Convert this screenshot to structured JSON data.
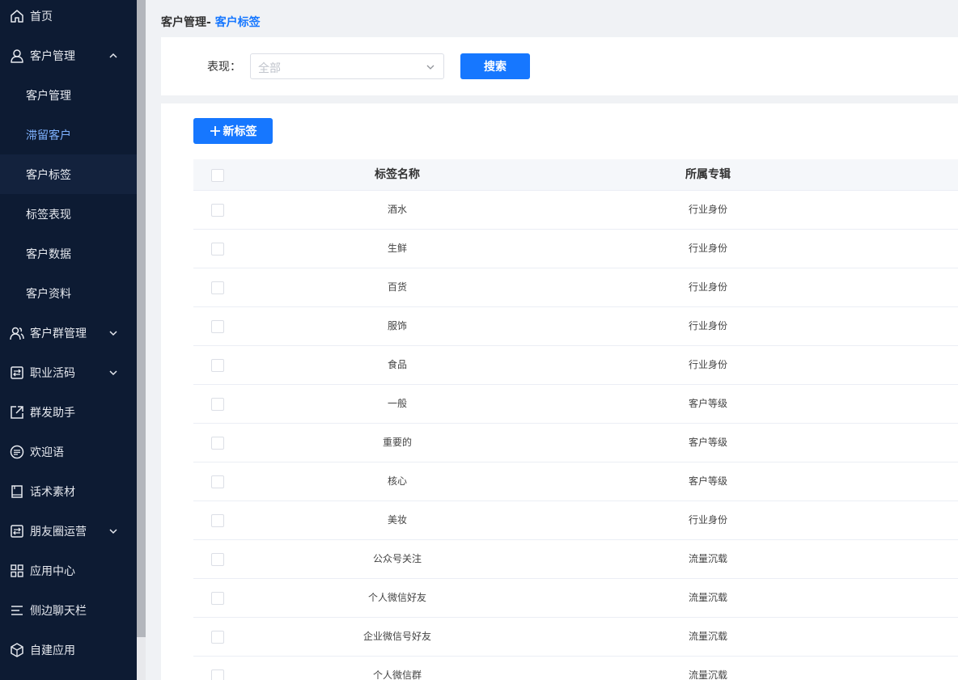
{
  "sidebar": {
    "items": [
      {
        "label": "首页",
        "icon": "home-icon"
      },
      {
        "label": "客户管理",
        "icon": "user-icon",
        "expanded": true,
        "children": [
          {
            "label": "客户管理"
          },
          {
            "label": "滞留客户"
          },
          {
            "label": "客户标签"
          },
          {
            "label": "标签表现"
          },
          {
            "label": "客户数据"
          },
          {
            "label": "客户资料"
          }
        ]
      },
      {
        "label": "客户群管理",
        "icon": "users-icon"
      },
      {
        "label": "职业活码",
        "icon": "qrcode-icon"
      },
      {
        "label": "群发助手",
        "icon": "share-icon"
      },
      {
        "label": "欢迎语",
        "icon": "message-icon"
      },
      {
        "label": "话术素材",
        "icon": "book-icon"
      },
      {
        "label": "朋友圈运营",
        "icon": "moments-icon"
      },
      {
        "label": "应用中心",
        "icon": "apps-icon"
      },
      {
        "label": "侧边聊天栏",
        "icon": "menu-icon"
      },
      {
        "label": "自建应用",
        "icon": "cube-icon"
      }
    ]
  },
  "breadcrumb": {
    "parent": "客户管理-",
    "current": "客户标签"
  },
  "filter": {
    "label": "表现：",
    "select_value": "全部",
    "search_button": "搜索"
  },
  "table": {
    "new_button": "新标签",
    "columns": [
      "标签名称",
      "所属专辑"
    ],
    "rows": [
      {
        "name": "酒水",
        "album": "行业身份"
      },
      {
        "name": "生鲜",
        "album": "行业身份"
      },
      {
        "name": "百货",
        "album": "行业身份"
      },
      {
        "name": "服饰",
        "album": "行业身份"
      },
      {
        "name": "食品",
        "album": "行业身份"
      },
      {
        "name": "一般",
        "album": "客户等级"
      },
      {
        "name": "重要的",
        "album": "客户等级"
      },
      {
        "name": "核心",
        "album": "客户等级"
      },
      {
        "name": "美妆",
        "album": "行业身份"
      },
      {
        "name": "公众号关注",
        "album": "流量沉载"
      },
      {
        "name": "个人微信好友",
        "album": "流量沉载"
      },
      {
        "name": "企业微信号好友",
        "album": "流量沉载"
      },
      {
        "name": "个人微信群",
        "album": "流量沉载"
      }
    ]
  },
  "colors": {
    "sidebar_bg": "#0d1b33",
    "accent": "#1677ff",
    "active_sub_bg": "#13223d"
  }
}
